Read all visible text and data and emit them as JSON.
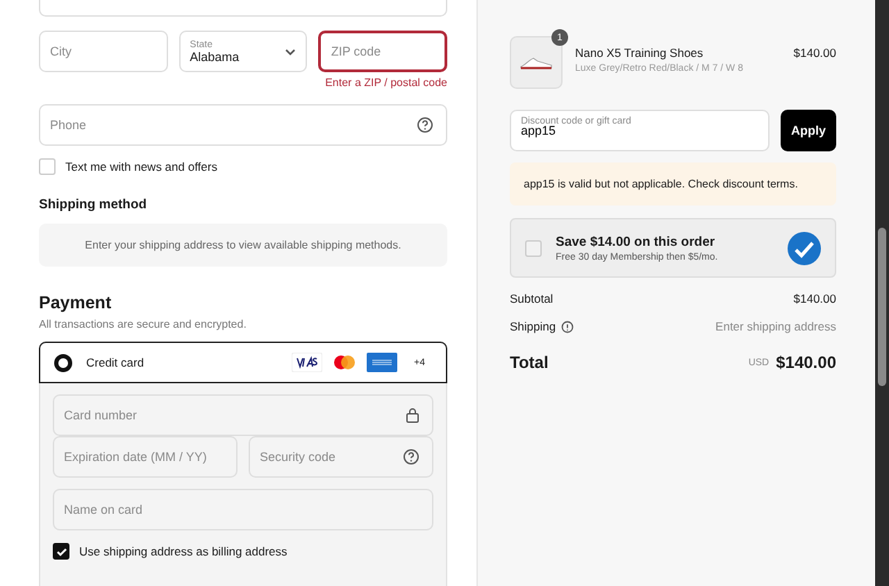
{
  "address": {
    "city": {
      "placeholder": "City"
    },
    "state": {
      "label": "State",
      "value": "Alabama"
    },
    "zip": {
      "placeholder": "ZIP code",
      "error": "Enter a ZIP / postal code",
      "invalid": true
    },
    "phone": {
      "placeholder": "Phone"
    },
    "sms_optin": {
      "label": "Text me with news and offers",
      "checked": false
    }
  },
  "shipping_method": {
    "heading": "Shipping method",
    "message": "Enter your shipping address to view available shipping methods."
  },
  "payment": {
    "heading": "Payment",
    "subtitle": "All transactions are secure and encrypted.",
    "methods": [
      {
        "label": "Credit card",
        "selected": true,
        "more_cards": "+4"
      }
    ],
    "card_number": {
      "placeholder": "Card number"
    },
    "expiration": {
      "placeholder": "Expiration date (MM / YY)"
    },
    "security_code": {
      "placeholder": "Security code"
    },
    "name_on_card": {
      "placeholder": "Name on card"
    },
    "billing_same": {
      "label": "Use shipping address as billing address",
      "checked": true
    }
  },
  "summary": {
    "items": [
      {
        "name": "Nano X5 Training Shoes",
        "variant": "Luxe Grey/Retro Red/Black / M 7 / W 8",
        "price": "$140.00",
        "quantity": "1"
      }
    ],
    "discount": {
      "label": "Discount code or gift card",
      "value": "app15",
      "button": "Apply",
      "notice": "app15 is valid but not applicable. Check discount terms."
    },
    "membership": {
      "title": "Save $14.00 on this order",
      "subtitle": "Free 30 day Membership then $5/mo.",
      "checked": false
    },
    "lines": [
      {
        "kind": "plain",
        "label": "Subtotal",
        "value": "$140.00"
      },
      {
        "kind": "help",
        "label": "Shipping",
        "value": "Enter shipping address"
      }
    ],
    "total": {
      "label": "Total",
      "currency": "USD",
      "value": "$140.00"
    }
  }
}
